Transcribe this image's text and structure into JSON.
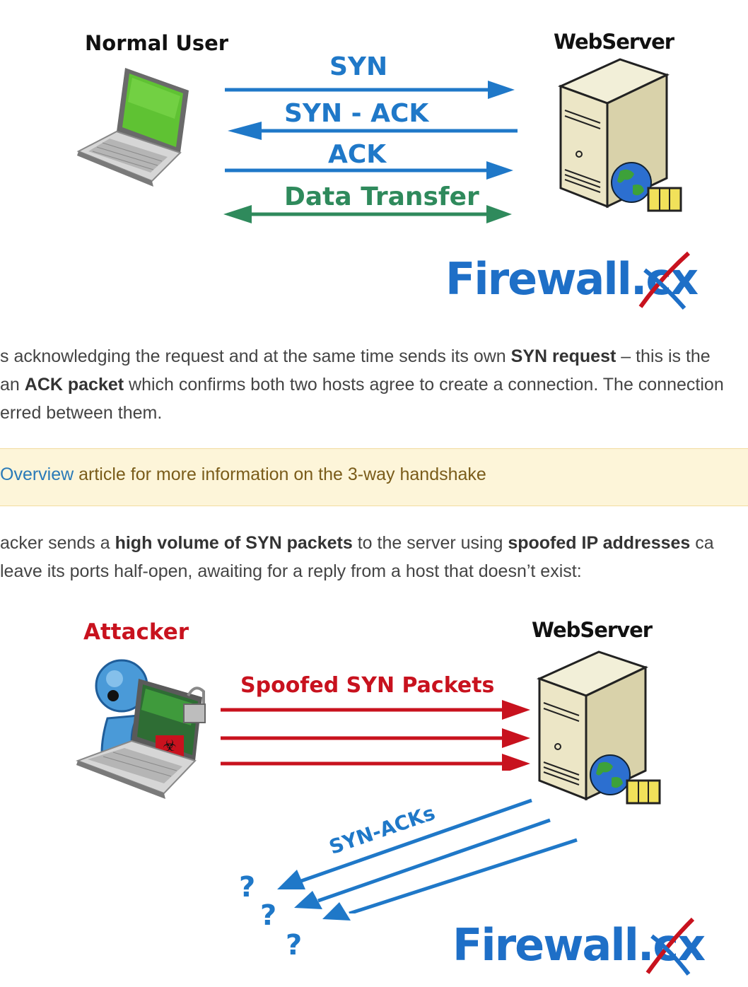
{
  "diagram1": {
    "client_label": "Normal User",
    "server_label": "WebServer",
    "steps": [
      "SYN",
      "SYN - ACK",
      "ACK",
      "Data Transfer"
    ],
    "brand": "Firewall.cx"
  },
  "paragraph1": {
    "line1_a": "s acknowledging the request and at the same time sends its own ",
    "line1_b": "SYN request",
    "line1_c": " – this is the",
    "line2_a": "an ",
    "line2_b": "ACK packet",
    "line2_c": " which confirms both two hosts agree to create a connection. The connection",
    "line3": "erred between them."
  },
  "note": {
    "link_text": "Overview",
    "text": " article for more information on the 3-way handshake"
  },
  "paragraph2": {
    "line1_a": "acker sends a ",
    "line1_b": "high volume of SYN packets",
    "line1_c": " to the server using ",
    "line1_d": "spoofed IP addresses",
    "line1_e": " ca",
    "line2": " leave its ports half-open, awaiting for a reply from a host that doesn’t exist:"
  },
  "diagram2": {
    "attacker_label": "Attacker",
    "server_label": "WebServer",
    "spoofed_label": "Spoofed SYN Packets",
    "synack_label": "SYN-ACKs",
    "unknown_marks": [
      "?",
      "?",
      "?"
    ],
    "brand": "Firewall.cx"
  },
  "colors": {
    "blue_arrow": "#1f78c8",
    "green_arrow": "#2f8a5c",
    "red_arrow": "#c8121e",
    "brand_blue": "#1e6fc7",
    "note_bg": "#fdf5d9"
  }
}
